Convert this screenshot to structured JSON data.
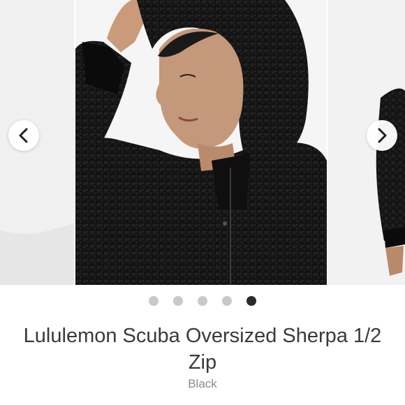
{
  "carousel": {
    "prev_icon": "chevron-left-icon",
    "next_icon": "chevron-right-icon",
    "dots": [
      {
        "active": false
      },
      {
        "active": false
      },
      {
        "active": false
      },
      {
        "active": false
      },
      {
        "active": true
      }
    ]
  },
  "product": {
    "name": "Lululemon Scuba Oversized Sherpa 1/2 Zip",
    "color": "Black"
  },
  "theme": {
    "dot_active": "#2b2b2b",
    "dot_inactive": "#c9c9c9",
    "title_color": "#3a3a3a",
    "subtitle_color": "#8a8a8a"
  }
}
